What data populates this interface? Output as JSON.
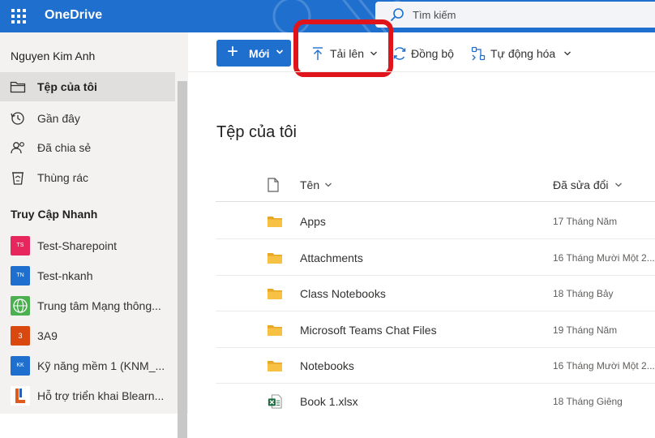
{
  "header": {
    "app_title": "OneDrive",
    "search_placeholder": "Tìm kiếm"
  },
  "sidebar": {
    "user_name": "Nguyen Kim Anh",
    "nav": [
      {
        "label": "Tệp của tôi",
        "icon": "folder-icon",
        "active": true
      },
      {
        "label": "Gần đây",
        "icon": "history-icon"
      },
      {
        "label": "Đã chia sẻ",
        "icon": "shared-people-icon"
      },
      {
        "label": "Thùng rác",
        "icon": "recycle-bin-icon"
      }
    ],
    "quick_access_title": "Truy Cập Nhanh",
    "quick_access": [
      {
        "label": "Test-Sharepoint",
        "badge": "TS",
        "color": "#e8265e"
      },
      {
        "label": "Test-nkanh",
        "badge": "TN",
        "color": "#1f6fce"
      },
      {
        "label": "Trung tâm Mạng thông...",
        "badge": "",
        "color": "#4caf50"
      },
      {
        "label": "3A9",
        "badge": "3",
        "color": "#d9480f"
      },
      {
        "label": "Kỹ năng mềm 1 (KNM_...",
        "badge": "KK",
        "color": "#1f6fce"
      },
      {
        "label": "Hỗ trợ triển khai Blearn...",
        "badge": "",
        "color": "#e05a1e"
      }
    ]
  },
  "commands": {
    "new_label": "Mới",
    "upload_label": "Tải lên",
    "sync_label": "Đồng bộ",
    "automate_label": "Tự động hóa"
  },
  "main": {
    "title": "Tệp của tôi",
    "columns": {
      "name": "Tên",
      "modified": "Đã sửa đổi"
    },
    "files": [
      {
        "name": "Apps",
        "modified": "17 Tháng Năm",
        "type": "folder"
      },
      {
        "name": "Attachments",
        "modified": "16 Tháng Mười Một 2...",
        "type": "folder"
      },
      {
        "name": "Class Notebooks",
        "modified": "18 Tháng Bảy",
        "type": "folder"
      },
      {
        "name": "Microsoft Teams Chat Files",
        "modified": "19 Tháng Năm",
        "type": "folder"
      },
      {
        "name": "Notebooks",
        "modified": "16 Tháng Mười Một 2...",
        "type": "folder"
      },
      {
        "name": "Book 1.xlsx",
        "modified": "18 Tháng Giêng",
        "type": "excel"
      }
    ]
  },
  "colors": {
    "brand": "#1f6fce",
    "highlight": "#e0141b",
    "folder": "#f7c244",
    "excel": "#1d6f42"
  }
}
